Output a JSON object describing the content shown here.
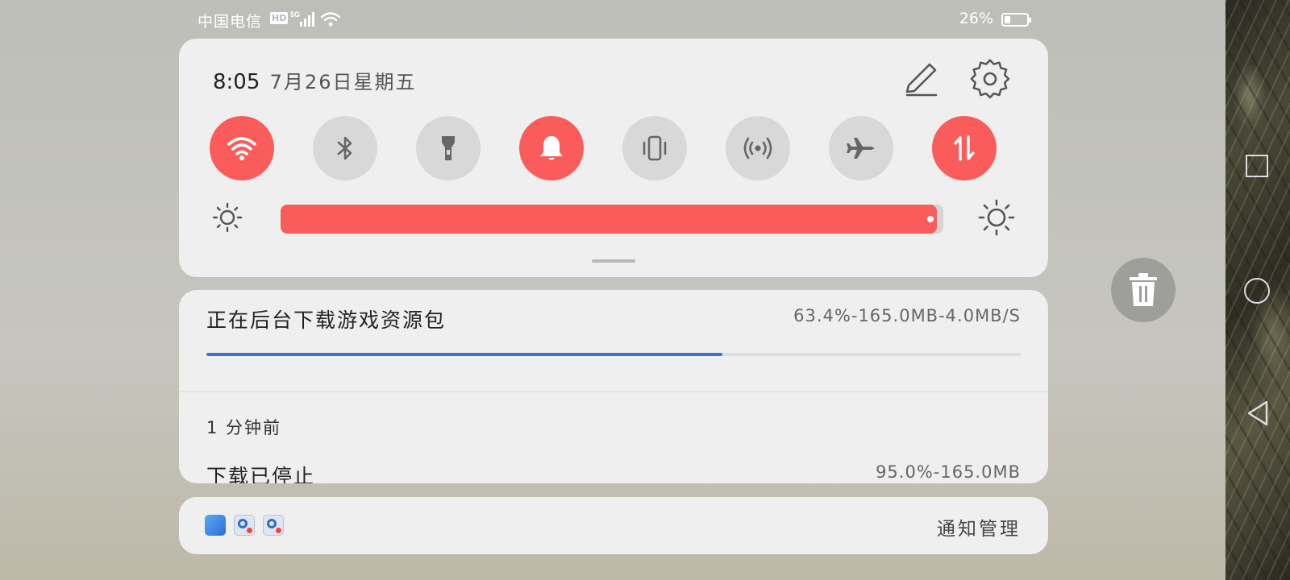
{
  "status_bar": {
    "carrier": "中国电信",
    "hd": "HD",
    "network": "5G",
    "battery_text": "26%",
    "battery_level": 0.26
  },
  "quick_settings": {
    "time": "8:05",
    "date": "7月26日星期五",
    "toggles": [
      {
        "name": "wifi",
        "on": true
      },
      {
        "name": "bluetooth",
        "on": false
      },
      {
        "name": "flashlight",
        "on": false
      },
      {
        "name": "sound",
        "on": true
      },
      {
        "name": "vibrate",
        "on": false
      },
      {
        "name": "hotspot",
        "on": false
      },
      {
        "name": "airplane-mode",
        "on": false
      },
      {
        "name": "mobile-data",
        "on": true
      }
    ],
    "brightness_level": 0.99,
    "accent_color": "#fa5c5c"
  },
  "notifications": [
    {
      "title": "正在后台下载游戏资源包",
      "meta": "63.4%-165.0MB-4.0MB/S",
      "progress": 0.634
    },
    {
      "time": "1 分钟前",
      "title": "下载已停止",
      "meta": "95.0%-165.0MB"
    }
  ],
  "footer": {
    "manage_label": "通知管理"
  }
}
